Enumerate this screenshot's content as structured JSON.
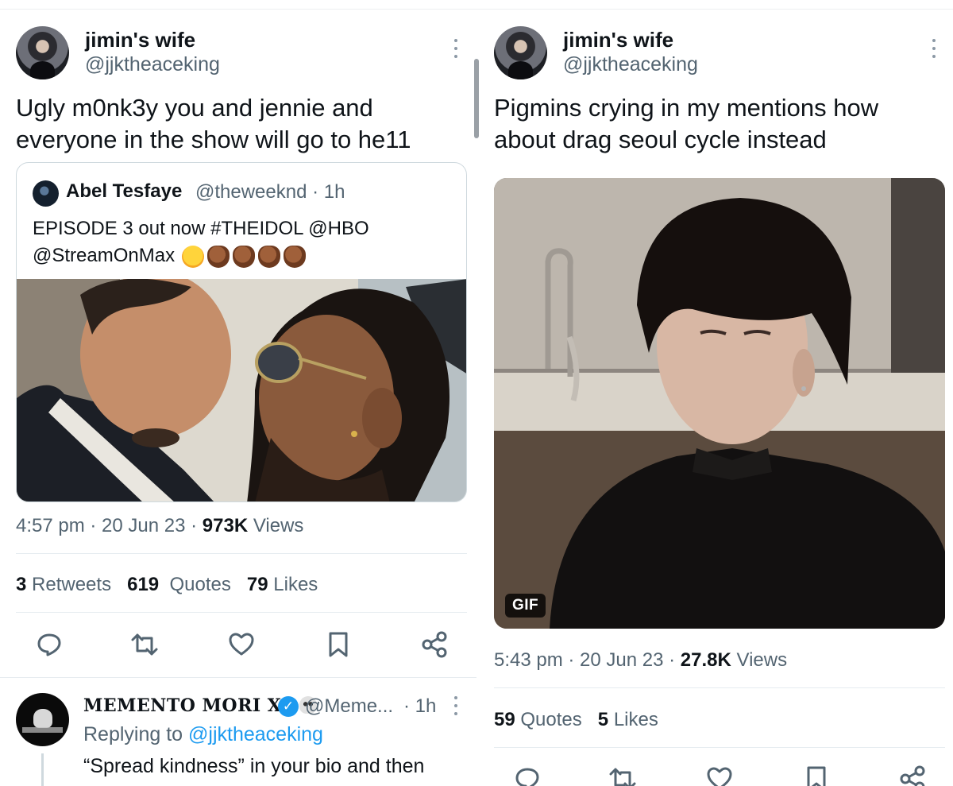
{
  "left_tweet": {
    "author_name": "jimin's wife",
    "author_handle": "@jjktheaceking",
    "text_lines": [
      "Ugly m0nk3y you and jennie and",
      "everyone in the show will go to he11"
    ],
    "quote": {
      "name": "Abel Tesfaye",
      "handle_time": "@theweeknd · 1h",
      "text_line1": "EPISODE 3 out now #THEIDOL @HBO",
      "text_line2": "@StreamOnMax",
      "emojis": [
        "hand-over-mouth-emoji",
        "clapping-hands-emoji",
        "clapping-hands-emoji",
        "clapping-hands-emoji",
        "clapping-hands-emoji"
      ]
    },
    "time": "4:57 pm",
    "date": "20 Jun 23",
    "views_count": "973K",
    "views_label": "Views",
    "retweets_count": "3",
    "retweets_label": "Retweets",
    "quotes_count": "619",
    "quotes_label": "Quotes",
    "likes_count": "79",
    "likes_label": "Likes",
    "actions": [
      "reply-icon",
      "retweet-icon",
      "like-icon",
      "bookmark-icon",
      "share-icon"
    ]
  },
  "reply": {
    "name": "MEMENTO MORI XO",
    "handle": "@Meme...",
    "time": "· 1h",
    "replying_prefix": "Replying to",
    "replying_to": "@jjktheaceking",
    "text": "“Spread kindness” in your bio and then"
  },
  "right_tweet": {
    "author_name": "jimin's wife",
    "author_handle": "@jjktheaceking",
    "text_lines": [
      "Pigmins crying in my mentions how",
      "about drag seoul cycle instead"
    ],
    "gif_label": "GIF",
    "time": "5:43 pm",
    "date": "20 Jun 23",
    "views_count": "27.8K",
    "views_label": "Views",
    "quotes_count": "59",
    "quotes_label": "Quotes",
    "likes_count": "5",
    "likes_label": "Likes"
  },
  "colors": {
    "primary_text": "#0f1419",
    "secondary_text": "#536471",
    "link": "#1d9bf0",
    "border": "#cfd9de"
  }
}
